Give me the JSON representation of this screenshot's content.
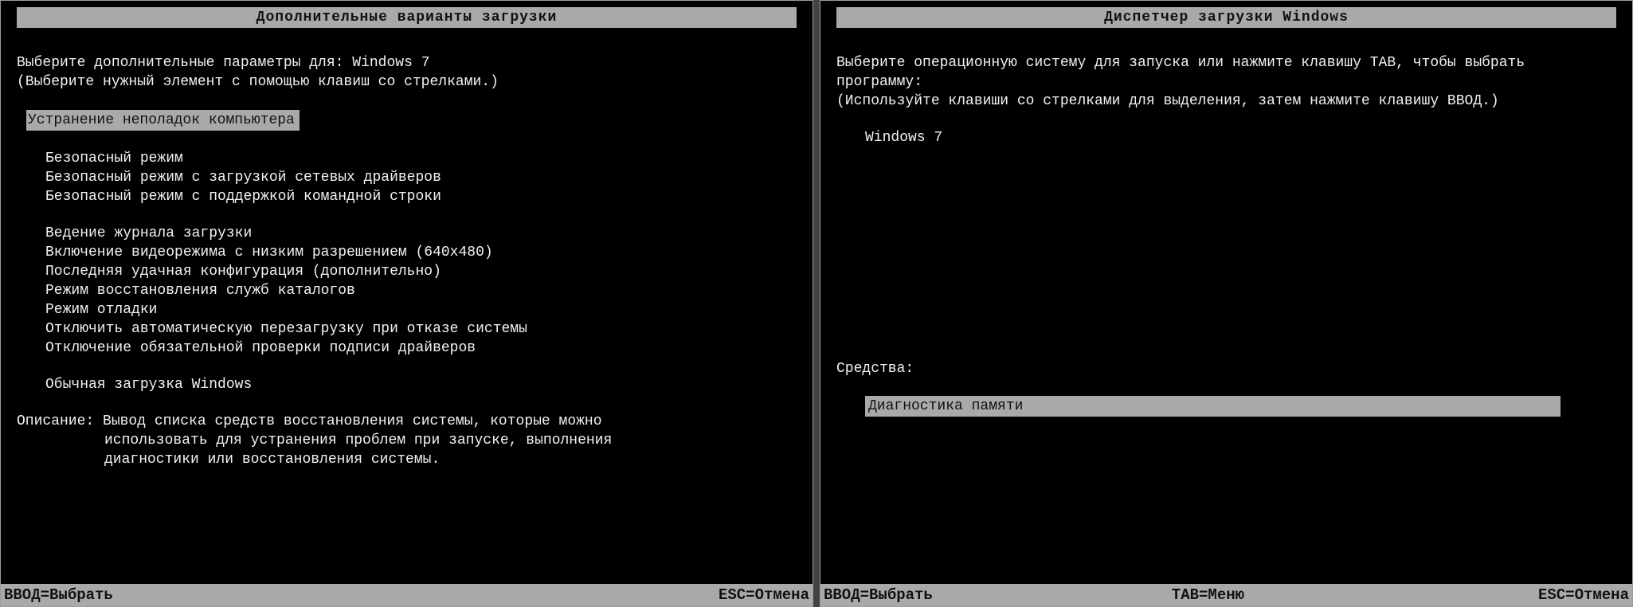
{
  "left": {
    "title": "Дополнительные варианты загрузки",
    "prompt_prefix": "Выберите дополнительные параметры для:",
    "prompt_os": "Windows 7",
    "hint": "(Выберите нужный элемент с помощью клавиш со стрелками.)",
    "selected": "Устранение неполадок компьютера",
    "items": [
      "Безопасный режим",
      "Безопасный режим с загрузкой сетевых драйверов",
      "Безопасный режим с поддержкой командной строки"
    ],
    "items2": [
      "Ведение журнала загрузки",
      "Включение видеорежима с низким разрешением (640x480)",
      "Последняя удачная конфигурация (дополнительно)",
      "Режим восстановления служб каталогов",
      "Режим отладки",
      "Отключить автоматическую перезагрузку при отказе системы",
      "Отключение обязательной проверки подписи драйверов"
    ],
    "items3": [
      "Обычная загрузка Windows"
    ],
    "desc_label": "Описание:",
    "desc_line1": "Вывод списка средств восстановления системы, которые можно",
    "desc_line2": "использовать для устранения проблем при запуске, выполнения",
    "desc_line3": "диагностики или восстановления системы.",
    "footer": {
      "enter": "ВВОД=Выбрать",
      "esc": "ESC=Отмена"
    }
  },
  "right": {
    "title": "Диспетчер загрузки Windows",
    "prompt1": "Выберите операционную систему для запуска или нажмите клавишу TAB, чтобы выбрать",
    "prompt2": "программу:",
    "hint": "(Используйте клавиши со стрелками для выделения, затем нажмите клавишу ВВОД.)",
    "os_item": "Windows 7",
    "tools_label": "Средства:",
    "tools_selected": "Диагностика памяти",
    "footer": {
      "enter": "ВВОД=Выбрать",
      "tab": "TAB=Меню",
      "esc": "ESC=Отмена"
    }
  }
}
